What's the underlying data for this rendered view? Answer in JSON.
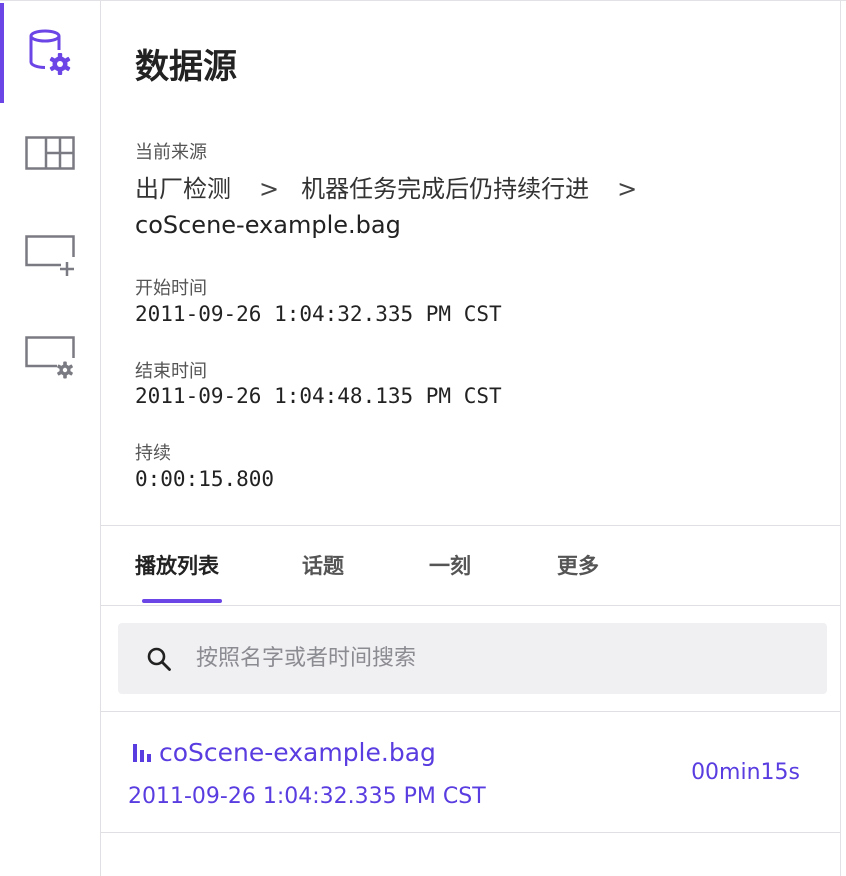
{
  "rail": {
    "items": [
      {
        "icon": "database-settings-icon",
        "active": true
      },
      {
        "icon": "layout-grid-icon",
        "active": false
      },
      {
        "icon": "add-panel-icon",
        "active": false
      },
      {
        "icon": "panel-settings-icon",
        "active": false
      }
    ]
  },
  "panel": {
    "title": "数据源",
    "current_source_label": "当前来源",
    "breadcrumb": [
      "出厂检测",
      "机器任务完成后仍持续行进"
    ],
    "breadcrumb_separator": ">",
    "filename": "coScene-example.bag",
    "start_label": "开始时间",
    "start_value": "2011-09-26 1:04:32.335 PM CST",
    "end_label": "结束时间",
    "end_value": "2011-09-26 1:04:48.135 PM CST",
    "duration_label": "持续",
    "duration_value": "0:00:15.800"
  },
  "tabs": [
    {
      "label": "播放列表",
      "active": true
    },
    {
      "label": "话题",
      "active": false
    },
    {
      "label": "一刻",
      "active": false
    },
    {
      "label": "更多",
      "active": false
    }
  ],
  "search": {
    "placeholder": "按照名字或者时间搜索",
    "value": ""
  },
  "playlist": [
    {
      "name": "coScene-example.bag",
      "time": "2011-09-26 1:04:32.335 PM CST",
      "duration": "00min15s",
      "icon": "bar-chart-icon"
    }
  ],
  "colors": {
    "accent": "#6b45e6",
    "link": "#5a3de0",
    "icon_gray": "#7a7a82"
  }
}
